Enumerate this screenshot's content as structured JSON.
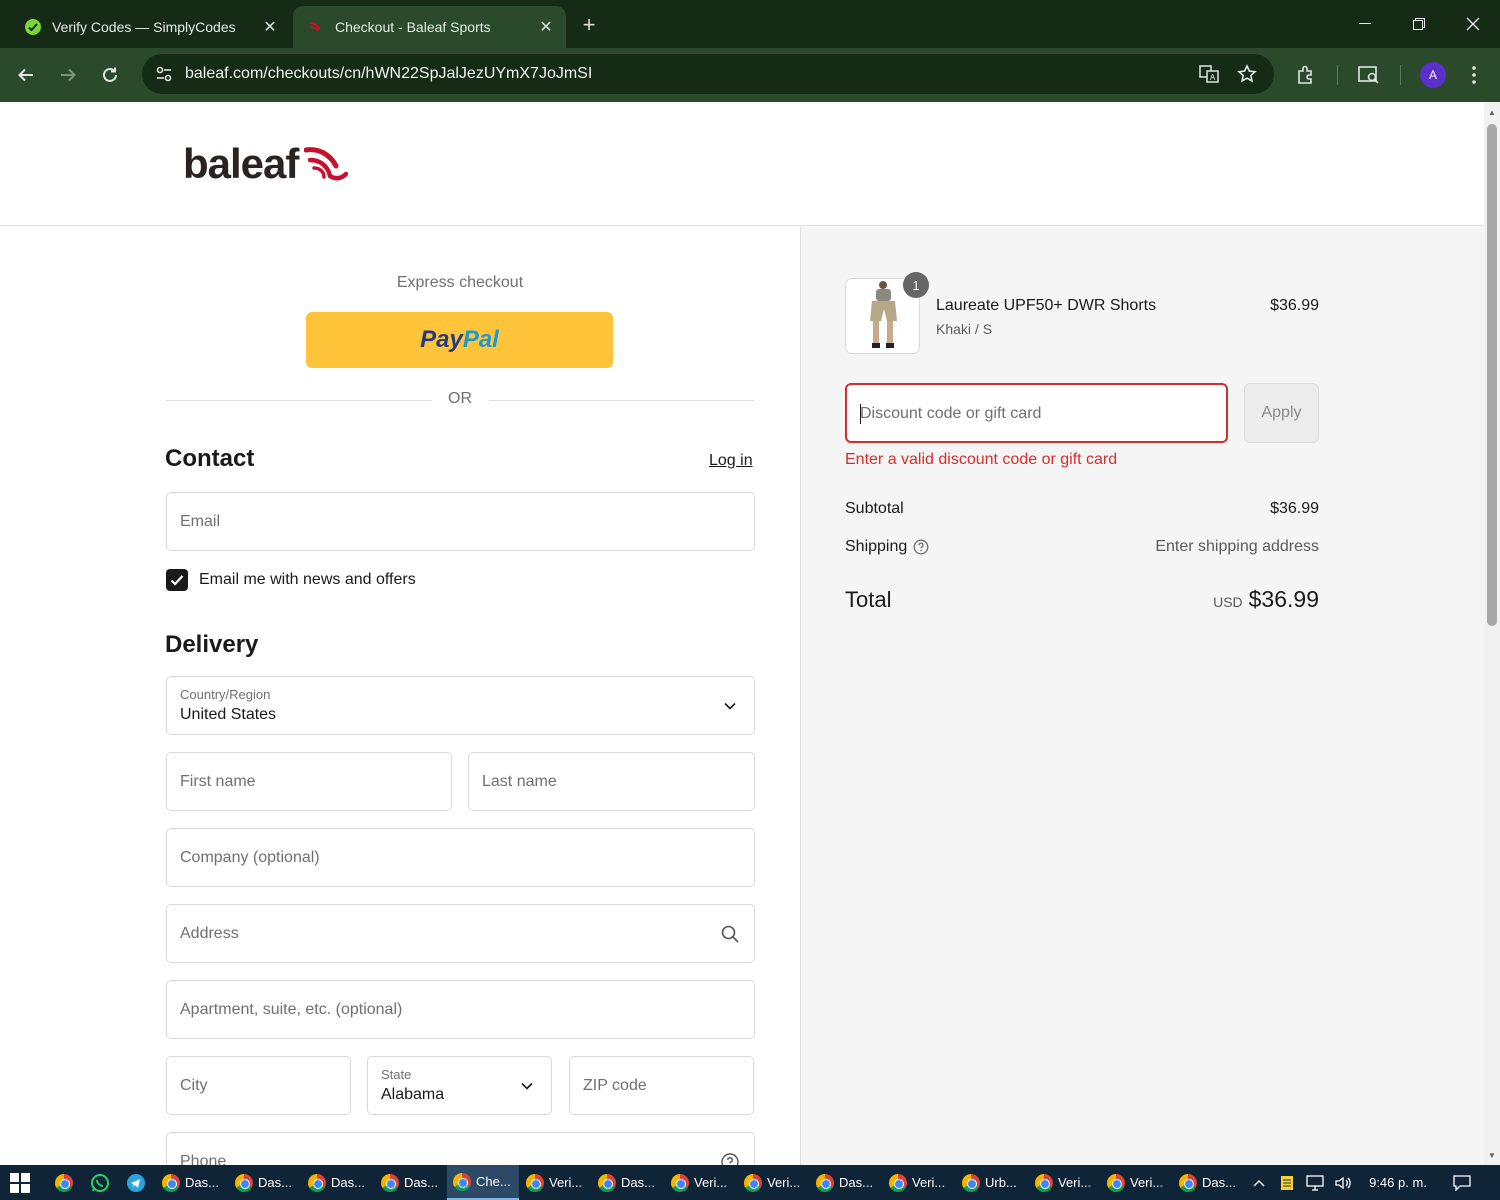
{
  "browser": {
    "tabs": [
      {
        "title": "Verify Codes — SimplyCodes",
        "icon": "simplycodes-favicon",
        "active": false
      },
      {
        "title": "Checkout - Baleaf Sports",
        "icon": "baleaf-favicon",
        "active": true
      }
    ],
    "url": "baleaf.com/checkouts/cn/hWN22SpJalJezUYmX7JoJmSI",
    "profile_initial": "A"
  },
  "header": {
    "logo_text": "baleaf",
    "brand_color": "#c8102e"
  },
  "express": {
    "label": "Express checkout",
    "paypal_pay": "Pay",
    "paypal_pal": "Pal",
    "or_label": "OR"
  },
  "contact": {
    "title": "Contact",
    "login_label": "Log in",
    "email_placeholder": "Email",
    "newsletter_label": "Email me with news and offers",
    "newsletter_checked": true
  },
  "delivery": {
    "title": "Delivery",
    "country_label": "Country/Region",
    "country_value": "United States",
    "first_name_placeholder": "First name",
    "last_name_placeholder": "Last name",
    "company_placeholder": "Company (optional)",
    "address_placeholder": "Address",
    "apartment_placeholder": "Apartment, suite, etc. (optional)",
    "city_placeholder": "City",
    "state_label": "State",
    "state_value": "Alabama",
    "zip_placeholder": "ZIP code",
    "phone_placeholder": "Phone"
  },
  "summary": {
    "product": {
      "name": "Laureate UPF50+ DWR Shorts",
      "variant": "Khaki / S",
      "price": "$36.99",
      "quantity": "1"
    },
    "discount_placeholder": "Discount code or gift card",
    "apply_label": "Apply",
    "error_message": "Enter a valid discount code or gift card",
    "subtotal_label": "Subtotal",
    "subtotal_value": "$36.99",
    "shipping_label": "Shipping",
    "shipping_value": "Enter shipping address",
    "total_label": "Total",
    "total_currency": "USD",
    "total_value": "$36.99"
  },
  "taskbar": {
    "apps": [
      {
        "label": "Das...",
        "active": false
      },
      {
        "label": "Das...",
        "active": false
      },
      {
        "label": "Das...",
        "active": false
      },
      {
        "label": "Das...",
        "active": false
      },
      {
        "label": "Che...",
        "active": true
      },
      {
        "label": "Veri...",
        "active": false
      },
      {
        "label": "Das...",
        "active": false
      },
      {
        "label": "Veri...",
        "active": false
      },
      {
        "label": "Veri...",
        "active": false
      },
      {
        "label": "Das...",
        "active": false
      },
      {
        "label": "Veri...",
        "active": false
      },
      {
        "label": "Urb...",
        "active": false
      },
      {
        "label": "Veri...",
        "active": false
      },
      {
        "label": "Veri...",
        "active": false
      },
      {
        "label": "Das...",
        "active": false
      }
    ],
    "clock": "9:46 p. m."
  },
  "colors": {
    "error": "#d72c2c",
    "paypal_yellow": "#ffc439",
    "chrome_dark": "#152b16",
    "chrome_toolbar": "#2a4a2b"
  }
}
